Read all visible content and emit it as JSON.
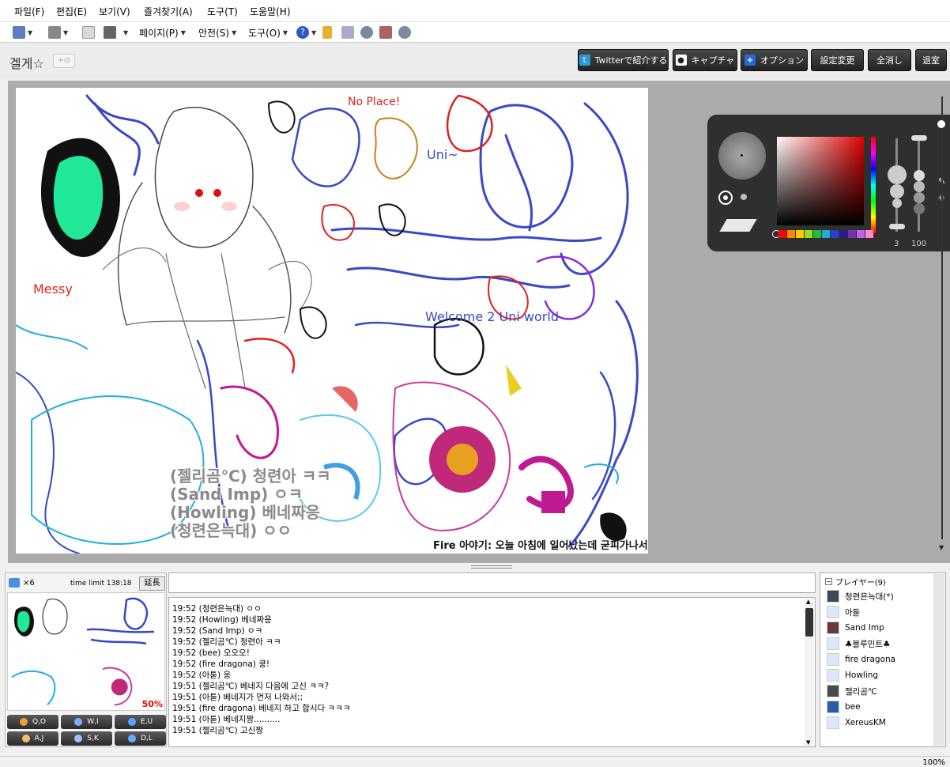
{
  "menu": [
    "파일(F)",
    "편집(E)",
    "보기(V)",
    "즐겨찾기(A)",
    "도구(T)",
    "도움말(H)"
  ],
  "ie_toolbar": {
    "page": "페이지(P)",
    "safety": "안전(S)",
    "tools": "도구(O)"
  },
  "room": {
    "title": "겔게☆",
    "plus": "+◎"
  },
  "header_buttons": {
    "twitter": "Twitterで紹介する",
    "capture": "キャプチャ",
    "option": "オプション",
    "settings": "設定変更",
    "clear_all": "全消し",
    "exit": "退室"
  },
  "palette": {
    "size": "3",
    "opacity": "100",
    "swatches": [
      "#ff0000",
      "#ff8800",
      "#ffcc00",
      "#99dd22",
      "#22bb44",
      "#22aadd",
      "#2244cc",
      "#2a1a8a",
      "#7733aa",
      "#bb66dd",
      "#ff88cc"
    ]
  },
  "canvas_overlay": [
    "(젤리곰℃) 청련아 ㅋㅋ",
    "(Sand Imp) ㅇㅋ",
    "(Howling) 베네짜응",
    "(청련은늑대) ㅇㅇ"
  ],
  "canvas_handwriting": "Fire 아야기: 오늘 아침에 일어났는데 굳피가나서",
  "thumb": {
    "count": "×6",
    "time_limit": "time limit 138:18",
    "extend": "延長",
    "zoom": "50%"
  },
  "tools": [
    {
      "label": "Q,O",
      "color": "#f0a030"
    },
    {
      "label": "W,I",
      "color": "#7ab0ff"
    },
    {
      "label": "E,U",
      "color": "#5aa0ff"
    },
    {
      "label": "A,J",
      "color": "#f2c070"
    },
    {
      "label": "S,K",
      "color": "#9ac0ff"
    },
    {
      "label": "D,L",
      "color": "#66aaff"
    }
  ],
  "chat": [
    "19:52 (청련은늑대) ㅇㅇ",
    "19:52 (Howling) 베네짜응",
    "19:52 (Sand Imp) ㅇㅋ",
    "19:52 (젤리곰℃) 청련아 ㅋㅋ",
    "19:52 (bee) 오오오!",
    "19:52 (fire dragona) 쿵!",
    "19:52 (아툳) 옹",
    "19:51 (젤리곰℃) 베네지 다음에 고신 ㅋㅋ?",
    "19:51 (아툳) 베네지가 먼저 나와서;;",
    "19:51 (fire dragona) 베네지 하고 합시다 ㅋㅋㅋ",
    "19:51 (아툳) 베네지짱..........",
    "19:51 (젤리곰℃) 고신짱"
  ],
  "players": {
    "header": "プレイヤー(9)",
    "list": [
      {
        "name": "청련은늑대(*)",
        "avatar": "#3a4a5a"
      },
      {
        "name": "아툳",
        "avatar": "#dbe8f8"
      },
      {
        "name": "Sand Imp",
        "avatar": "#6a3a3a"
      },
      {
        "name": "♣블루민트♣",
        "avatar": "#dbe8f8"
      },
      {
        "name": "fire dragona",
        "avatar": "#dbe8f8"
      },
      {
        "name": "Howling",
        "avatar": "#dbe8f8"
      },
      {
        "name": "젤리곰℃",
        "avatar": "#4a4a4a"
      },
      {
        "name": "bee",
        "avatar": "#2a5aaa"
      },
      {
        "name": "XereusKM",
        "avatar": "#dbe8f8"
      }
    ]
  },
  "status": {
    "zoom": "100%"
  }
}
